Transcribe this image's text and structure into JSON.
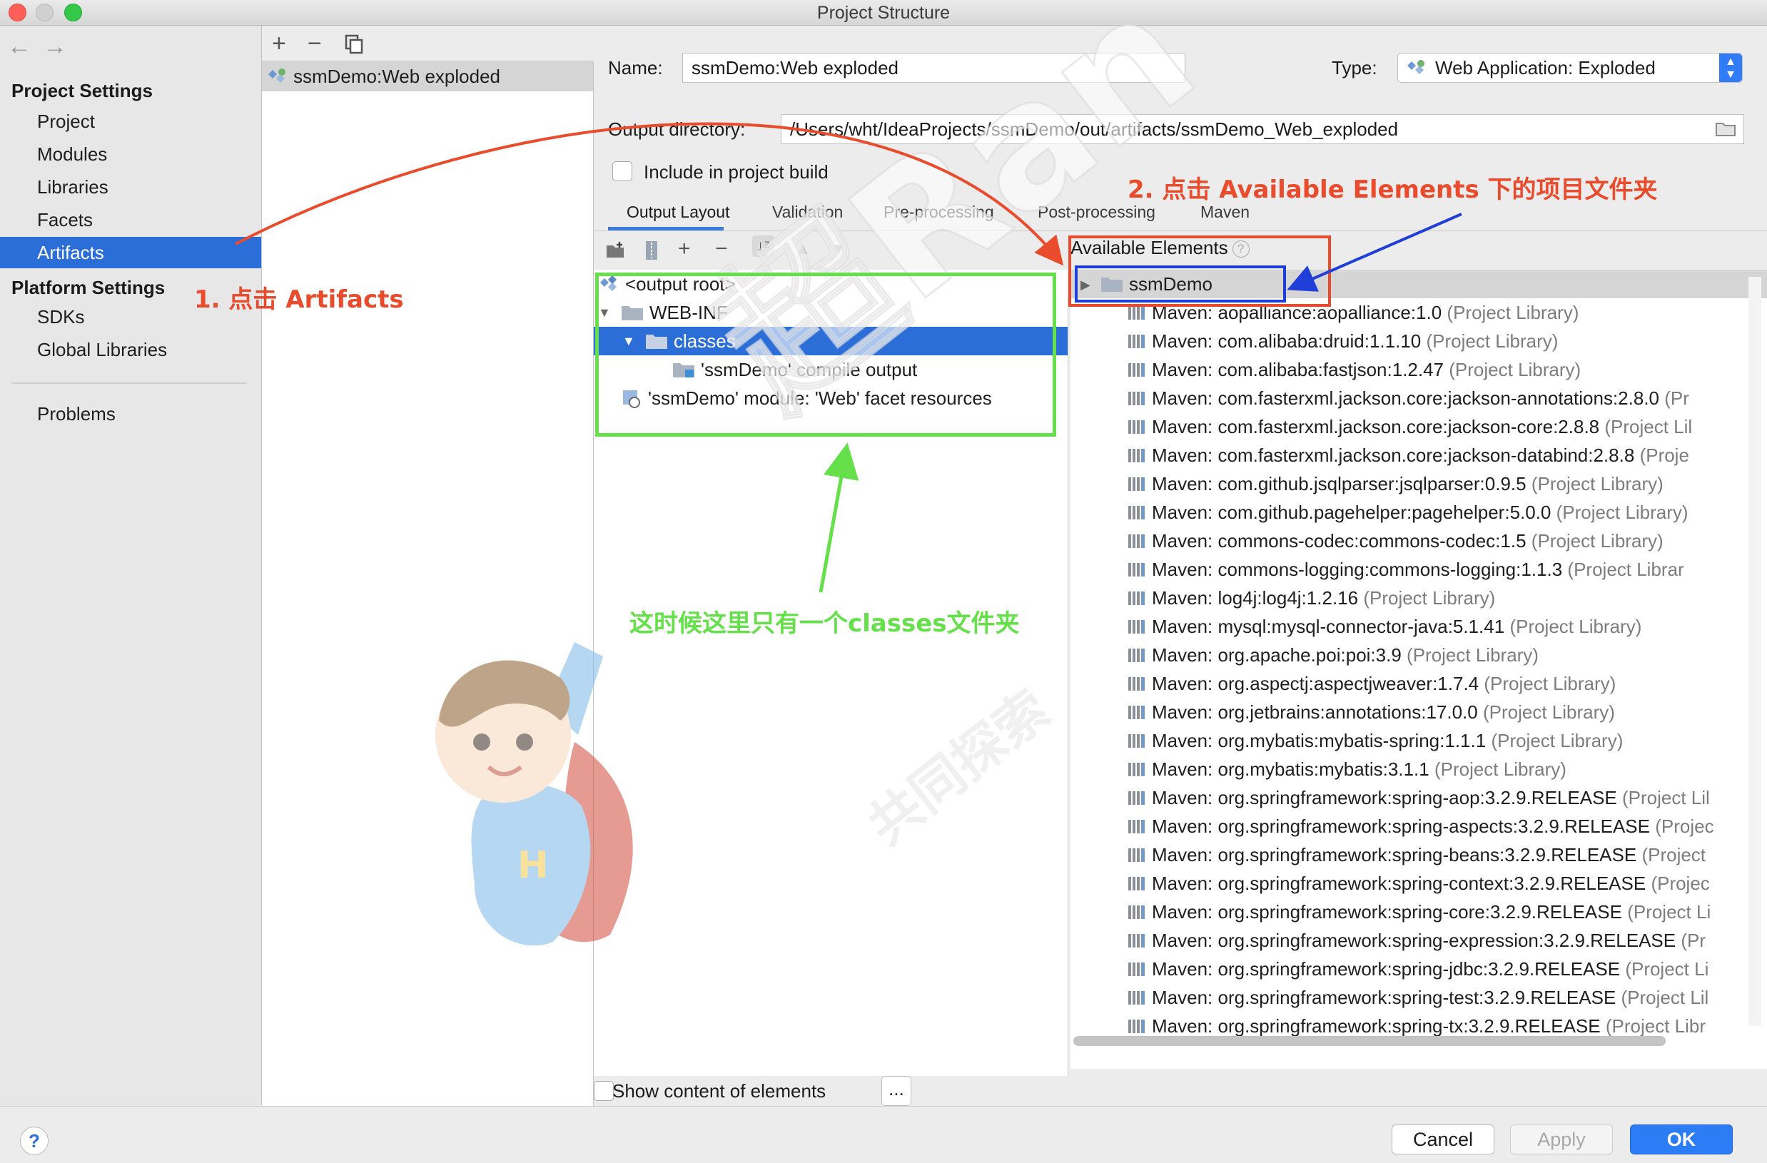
{
  "window": {
    "title": "Project Structure"
  },
  "nav": {
    "back": "←",
    "forward": "→"
  },
  "sidebar": {
    "project_settings": "Project Settings",
    "items": [
      "Project",
      "Modules",
      "Libraries",
      "Facets",
      "Artifacts"
    ],
    "platform_settings": "Platform Settings",
    "platform_items": [
      "SDKs",
      "Global Libraries"
    ],
    "problems": "Problems"
  },
  "artifact_list": {
    "toolbar": {
      "add": "+",
      "remove": "−"
    },
    "items": [
      "ssmDemo:Web exploded"
    ]
  },
  "config": {
    "name_label": "Name:",
    "name_value": "ssmDemo:Web exploded",
    "type_label": "Type:",
    "type_value": "Web Application: Exploded",
    "output_label": "Output directory:",
    "output_value": "/Users/wht/IdeaProjects/ssmDemo/out/artifacts/ssmDemo_Web_exploded",
    "include_label": "Include in project build",
    "tabs": [
      "Output Layout",
      "Validation",
      "Pre-processing",
      "Post-processing",
      "Maven"
    ]
  },
  "output_tree": [
    {
      "label": "<output root>"
    },
    {
      "label": "WEB-INF"
    },
    {
      "label": "classes"
    },
    {
      "label": "'ssmDemo' compile output"
    },
    {
      "label": "'ssmDemo' module: 'Web' facet resources"
    }
  ],
  "available": {
    "heading": "Available Elements",
    "help": "?",
    "root": "ssmDemo",
    "libraries": [
      {
        "name": "Maven: aopalliance:aopalliance:1.0",
        "suffix": "(Project Library)"
      },
      {
        "name": "Maven: com.alibaba:druid:1.1.10",
        "suffix": "(Project Library)"
      },
      {
        "name": "Maven: com.alibaba:fastjson:1.2.47",
        "suffix": "(Project Library)"
      },
      {
        "name": "Maven: com.fasterxml.jackson.core:jackson-annotations:2.8.0",
        "suffix": "(Pr"
      },
      {
        "name": "Maven: com.fasterxml.jackson.core:jackson-core:2.8.8",
        "suffix": "(Project Lil"
      },
      {
        "name": "Maven: com.fasterxml.jackson.core:jackson-databind:2.8.8",
        "suffix": "(Proje"
      },
      {
        "name": "Maven: com.github.jsqlparser:jsqlparser:0.9.5",
        "suffix": "(Project Library)"
      },
      {
        "name": "Maven: com.github.pagehelper:pagehelper:5.0.0",
        "suffix": "(Project Library)"
      },
      {
        "name": "Maven: commons-codec:commons-codec:1.5",
        "suffix": "(Project Library)"
      },
      {
        "name": "Maven: commons-logging:commons-logging:1.1.3",
        "suffix": "(Project Librar"
      },
      {
        "name": "Maven: log4j:log4j:1.2.16",
        "suffix": "(Project Library)"
      },
      {
        "name": "Maven: mysql:mysql-connector-java:5.1.41",
        "suffix": "(Project Library)"
      },
      {
        "name": "Maven: org.apache.poi:poi:3.9",
        "suffix": "(Project Library)"
      },
      {
        "name": "Maven: org.aspectj:aspectjweaver:1.7.4",
        "suffix": "(Project Library)"
      },
      {
        "name": "Maven: org.jetbrains:annotations:17.0.0",
        "suffix": "(Project Library)"
      },
      {
        "name": "Maven: org.mybatis:mybatis-spring:1.1.1",
        "suffix": "(Project Library)"
      },
      {
        "name": "Maven: org.mybatis:mybatis:3.1.1",
        "suffix": "(Project Library)"
      },
      {
        "name": "Maven: org.springframework:spring-aop:3.2.9.RELEASE",
        "suffix": "(Project Lil"
      },
      {
        "name": "Maven: org.springframework:spring-aspects:3.2.9.RELEASE",
        "suffix": "(Projec"
      },
      {
        "name": "Maven: org.springframework:spring-beans:3.2.9.RELEASE",
        "suffix": "(Project"
      },
      {
        "name": "Maven: org.springframework:spring-context:3.2.9.RELEASE",
        "suffix": "(Projec"
      },
      {
        "name": "Maven: org.springframework:spring-core:3.2.9.RELEASE",
        "suffix": "(Project Li"
      },
      {
        "name": "Maven: org.springframework:spring-expression:3.2.9.RELEASE",
        "suffix": "(Pr"
      },
      {
        "name": "Maven: org.springframework:spring-jdbc:3.2.9.RELEASE",
        "suffix": "(Project Li"
      },
      {
        "name": "Maven: org.springframework:spring-test:3.2.9.RELEASE",
        "suffix": "(Project Lil"
      },
      {
        "name": "Maven: org.springframework:spring-tx:3.2.9.RELEASE",
        "suffix": "(Project Libr"
      }
    ]
  },
  "show_content_label": "Show content of elements",
  "more_button": "...",
  "buttons": {
    "help": "?",
    "cancel": "Cancel",
    "apply": "Apply",
    "ok": "OK"
  },
  "annotations": {
    "step1": "1. 点击 Artifacts",
    "step2": "2. 点击 Available Elements 下的项目文件夹",
    "note": "这时候这里只有一个classes文件夹"
  },
  "watermark": {
    "logo": "超Ran",
    "tagline": "共同探索"
  },
  "colors": {
    "accent": "#2c6ed8",
    "annotation_red": "#e94c2c",
    "annotation_green": "#66e04a",
    "annotation_blue": "#1f3fd8"
  }
}
